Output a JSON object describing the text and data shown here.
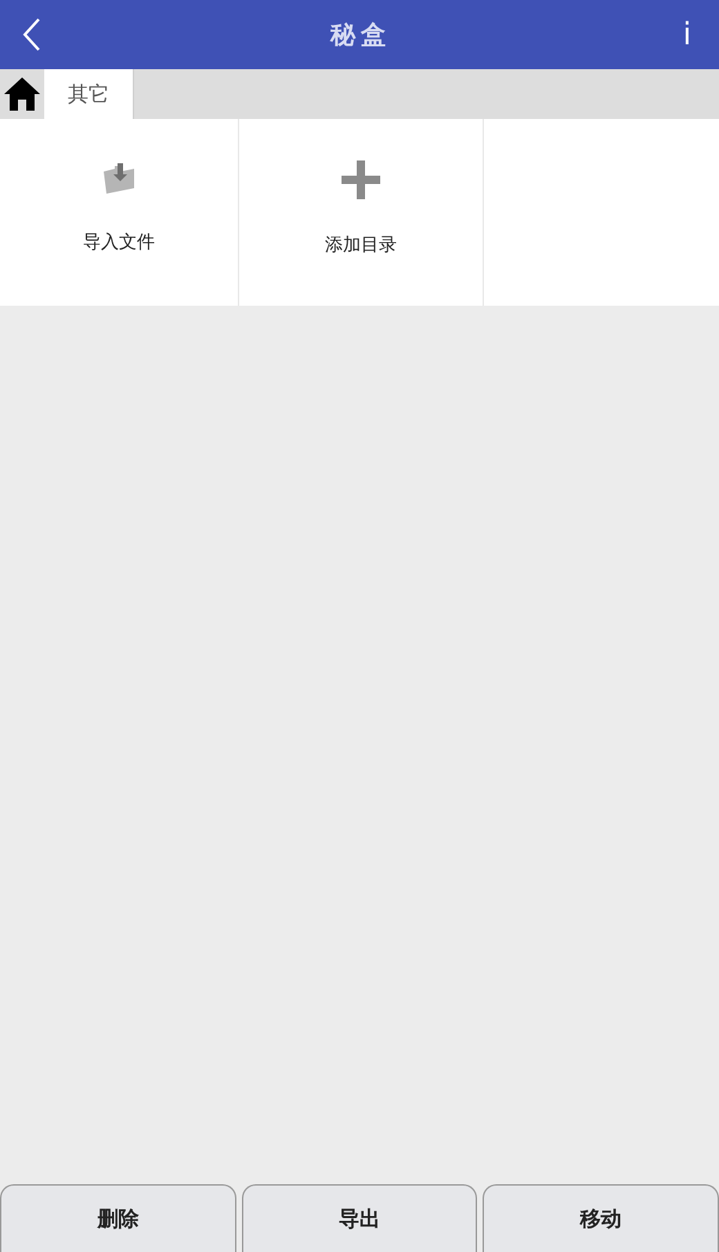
{
  "header": {
    "title": "秘盒",
    "info": "i"
  },
  "breadcrumb": {
    "items": [
      "其它"
    ]
  },
  "actions": [
    {
      "kind": "import",
      "label": "导入文件"
    },
    {
      "kind": "add",
      "label": "添加目录"
    }
  ],
  "buttons": [
    "删除",
    "导出",
    "移动"
  ]
}
